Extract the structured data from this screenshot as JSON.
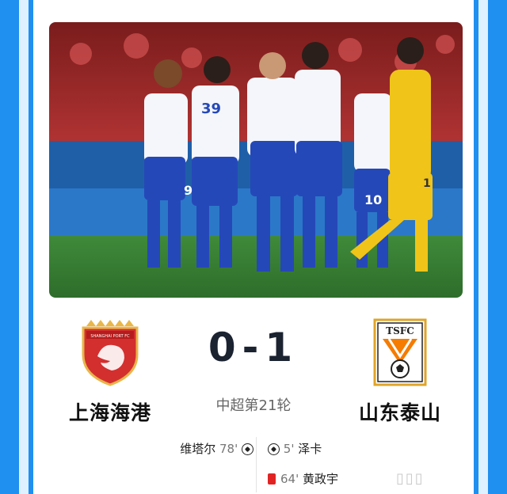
{
  "colors": {
    "background": "#1f8ff0",
    "home_crest": "#d32f2f",
    "away_crest": "#f57c00",
    "score": "#1b2230",
    "red_card": "#e02424"
  },
  "photo": {
    "description_icon": "team-celebration-photo",
    "jersey_numbers": [
      "9",
      "39",
      "10",
      "1"
    ]
  },
  "match": {
    "home": {
      "name": "上海海港",
      "crest_text": "SHANGHAI PORT FC",
      "crest_icon": "lion-crest-icon"
    },
    "away": {
      "name": "山东泰山",
      "crest_text": "TSFC",
      "crest_icon": "taishan-crest-icon"
    },
    "score": {
      "home": "0",
      "separator": "-",
      "away": "1"
    },
    "round": "中超第21轮"
  },
  "events": {
    "home": [
      {
        "player": "维塔尔",
        "minute": "78'",
        "type": "goal",
        "icon": "soccer-ball-icon"
      }
    ],
    "away": [
      {
        "player": "泽卡",
        "minute": "5'",
        "type": "goal",
        "icon": "soccer-ball-icon"
      },
      {
        "player": "黄政宇",
        "minute": "64'",
        "type": "red-card",
        "icon": "red-card-icon"
      }
    ]
  },
  "watermark": "▯▯▯"
}
